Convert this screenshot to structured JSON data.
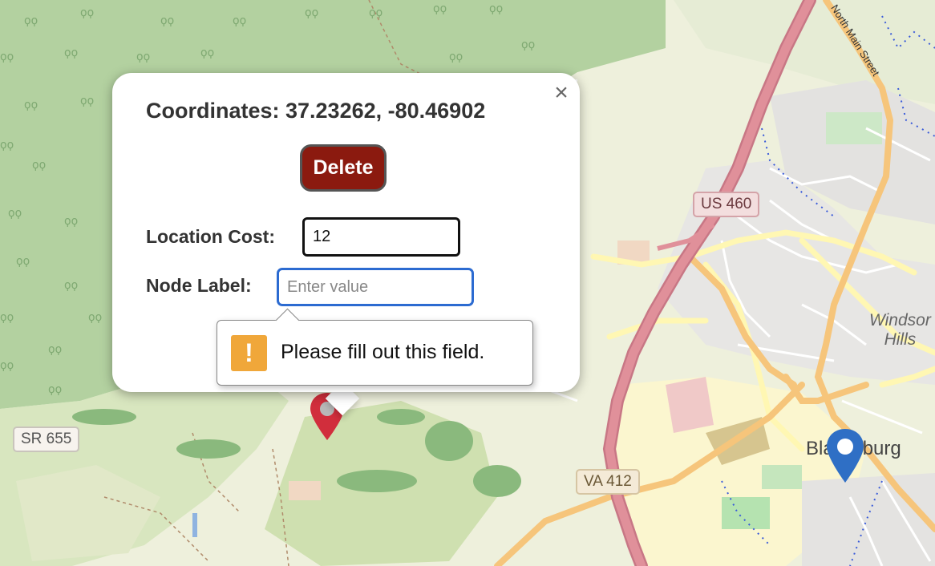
{
  "map": {
    "road_labels": {
      "us460": "US 460",
      "va412": "VA 412",
      "sr655": "SR 655"
    },
    "place_labels": {
      "windsor_hills": "Windsor\nHills",
      "town": "Blacksburg",
      "street": "North Main Street"
    },
    "colors": {
      "forest": "#a9cc98",
      "land": "#eef0dc",
      "highway": "#e0909a",
      "arterial": "#f6c57b",
      "local": "#fff7b3"
    }
  },
  "popup": {
    "coordinates": "Coordinates: 37.23262, -80.46902",
    "delete_label": "Delete",
    "cost_label": "Location Cost:",
    "cost_value": "12",
    "node_label": "Node Label:",
    "node_placeholder": "Enter value",
    "close_icon": "×"
  },
  "validation": {
    "message": "Please fill out this field.",
    "icon": "!"
  },
  "markers": {
    "selected_color": "#d12e3c",
    "other_color": "#2f6fc5"
  }
}
